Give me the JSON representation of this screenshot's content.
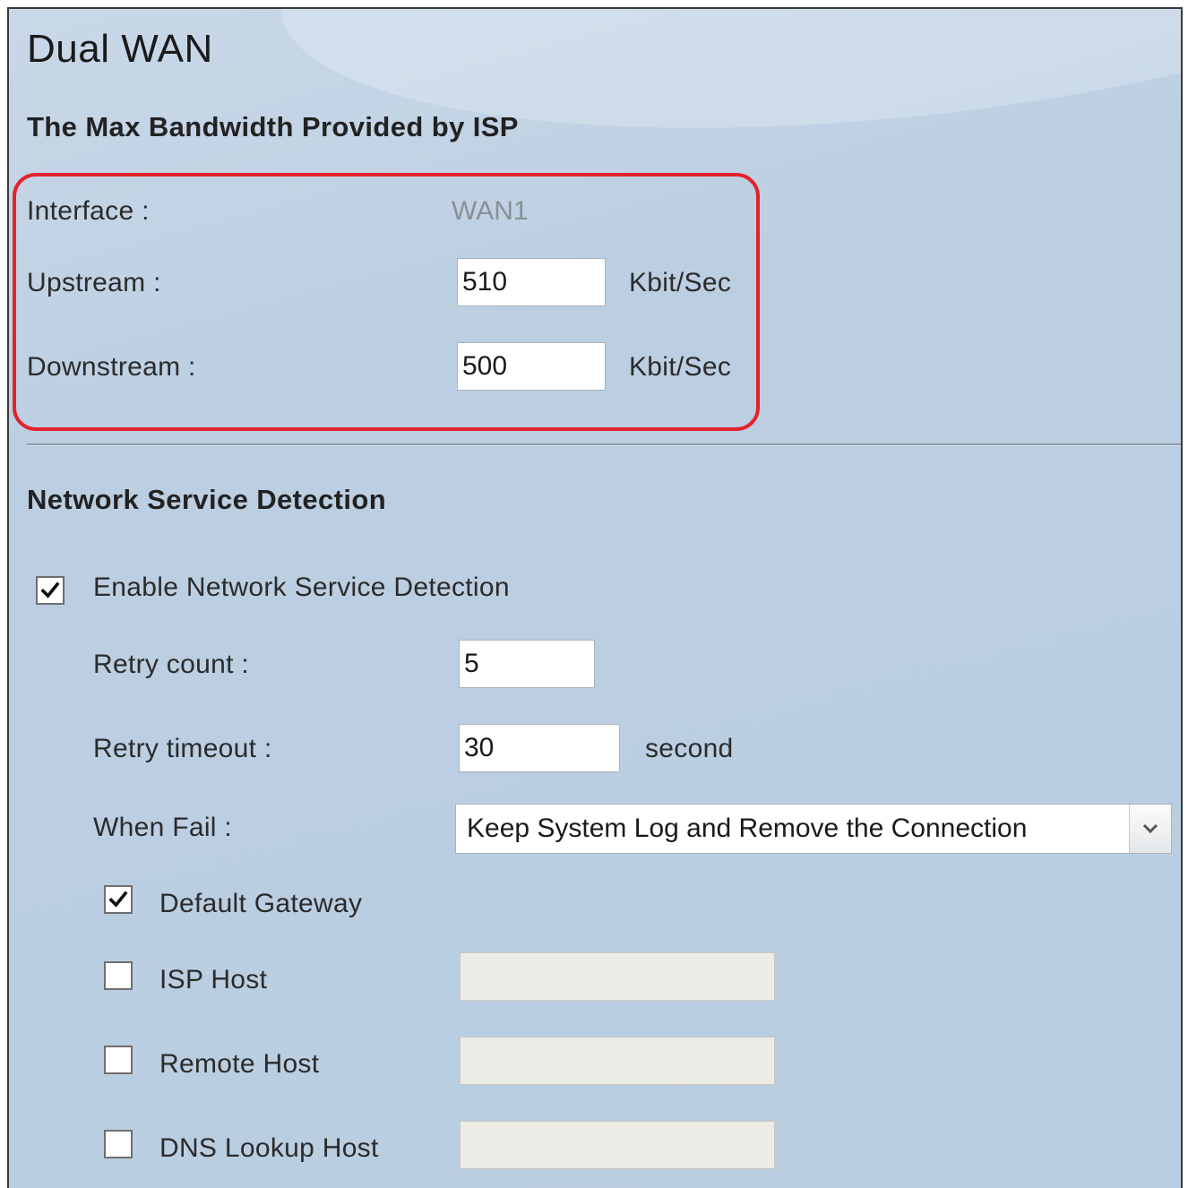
{
  "page": {
    "title": "Dual WAN"
  },
  "bandwidth": {
    "heading": "The Max Bandwidth Provided by ISP",
    "interface_label": "Interface :",
    "interface_value": "WAN1",
    "upstream_label": "Upstream :",
    "upstream_value": "510",
    "upstream_unit": "Kbit/Sec",
    "downstream_label": "Downstream :",
    "downstream_value": "500",
    "downstream_unit": "Kbit/Sec"
  },
  "detection": {
    "heading": "Network Service Detection",
    "enable_label": "Enable Network Service Detection",
    "enable_checked": true,
    "retry_count_label": "Retry count :",
    "retry_count_value": "5",
    "retry_timeout_label": "Retry timeout :",
    "retry_timeout_value": "30",
    "retry_timeout_unit": "second",
    "when_fail_label": "When Fail :",
    "when_fail_value": "Keep System Log and Remove the Connection",
    "default_gateway_label": "Default Gateway",
    "default_gateway_checked": true,
    "isp_host_label": "ISP Host",
    "isp_host_checked": false,
    "isp_host_value": "",
    "remote_host_label": "Remote Host",
    "remote_host_checked": false,
    "remote_host_value": "",
    "dns_lookup_host_label": "DNS Lookup Host",
    "dns_lookup_host_checked": false,
    "dns_lookup_host_value": ""
  },
  "icons": {
    "check": "check-icon",
    "dropdown": "chevron-down-icon"
  },
  "colors": {
    "highlight": "#e4222b",
    "panel_background": "#bccfe2"
  }
}
